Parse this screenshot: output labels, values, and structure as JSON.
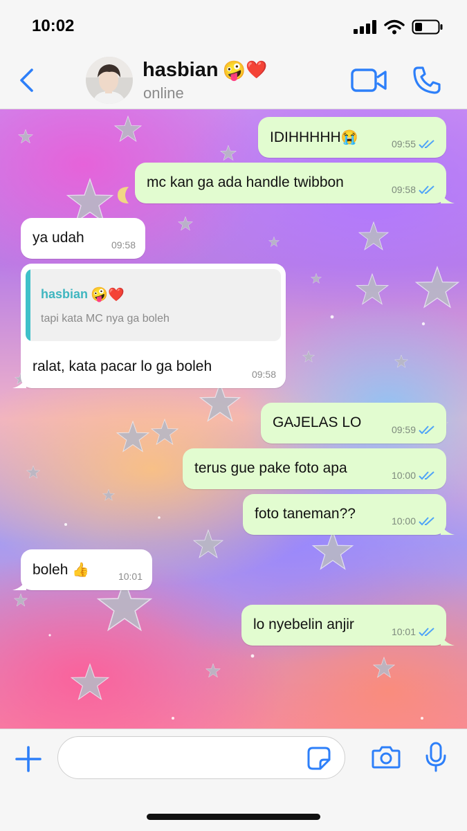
{
  "status_bar": {
    "time": "10:02"
  },
  "header": {
    "contact_name": "hasbian",
    "contact_status": "online",
    "name_emojis": [
      "🤪",
      "❤️"
    ]
  },
  "messages": [
    {
      "direction": "outgoing",
      "text": "IDIHHHHH",
      "emoji": "😭",
      "time": "09:55",
      "read": true
    },
    {
      "direction": "outgoing",
      "text": "mc kan ga ada handle twibbon",
      "time": "09:58",
      "read": true
    },
    {
      "direction": "incoming",
      "text": "ya udah",
      "time": "09:58"
    },
    {
      "direction": "incoming",
      "text": "ralat, kata pacar lo ga boleh",
      "time": "09:58",
      "reply_to": {
        "name": "hasbian",
        "name_emojis": [
          "🤪",
          "❤️"
        ],
        "text": "tapi kata MC nya ga boleh"
      }
    },
    {
      "direction": "outgoing",
      "text": "GAJELAS LO",
      "time": "09:59",
      "read": true
    },
    {
      "direction": "outgoing",
      "text": "terus gue pake foto apa",
      "time": "10:00",
      "read": true
    },
    {
      "direction": "outgoing",
      "text": "foto taneman??",
      "time": "10:00",
      "read": true
    },
    {
      "direction": "incoming",
      "text": "boleh",
      "emoji": "👍",
      "time": "10:01"
    },
    {
      "direction": "outgoing",
      "text": "lo nyebelin anjir",
      "time": "10:01",
      "read": true
    }
  ],
  "input": {
    "placeholder": "",
    "value": ""
  },
  "colors": {
    "accent": "#2d7ff9",
    "outgoing_bubble": "#e2fcd0",
    "incoming_bubble": "#ffffff",
    "read_ticks": "#4fa3f7",
    "quote_accent": "#3fc0c9"
  },
  "icons": {
    "back": "chevron-left-icon",
    "video_call": "video-camera-icon",
    "voice_call": "phone-icon",
    "attach": "plus-icon",
    "sticker": "sticker-icon",
    "camera": "camera-icon",
    "microphone": "microphone-icon"
  }
}
